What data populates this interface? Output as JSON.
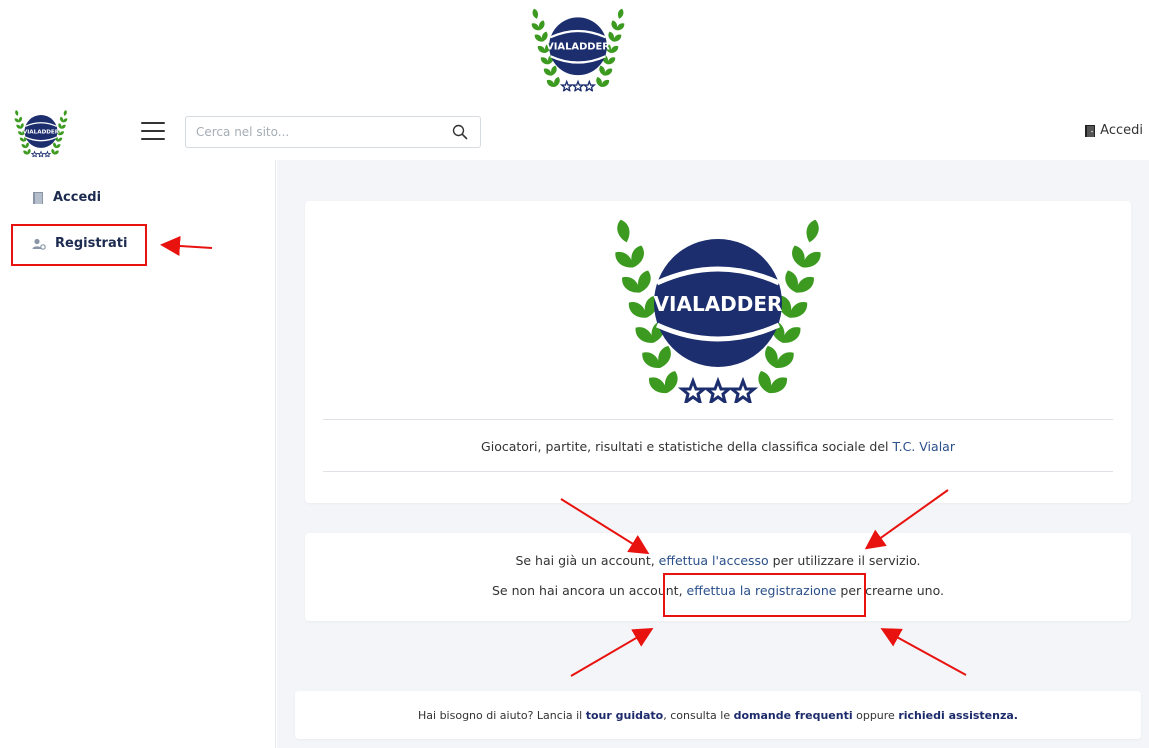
{
  "brand": {
    "logo_text": "VIALADDER"
  },
  "header": {
    "search_placeholder": "Cerca nel sito...",
    "login_label": "Accedi"
  },
  "sidebar": {
    "items": [
      {
        "label": "Accedi",
        "icon": "door-icon"
      },
      {
        "label": "Registrati",
        "icon": "user-add-icon"
      }
    ]
  },
  "hero": {
    "tagline_text": "Giocatori, partite, risultati e statistiche della classifica sociale del ",
    "tagline_link": "T.C. Vialar"
  },
  "info": {
    "line1_pre": "Se hai già un account, ",
    "line1_link": "effettua l'accesso",
    "line1_post": " per utilizzare il servizio.",
    "line2_pre": "Se non hai ancora un account, ",
    "line2_link": "effettua la registrazione",
    "line2_post": " per crearne uno."
  },
  "help": {
    "pre": "Hai bisogno di aiuto? Lancia il ",
    "link1": "tour guidato",
    "mid1": ", consulta le ",
    "link2": "domande frequenti",
    "mid2": " oppure ",
    "link3": "richiedi assistenza."
  },
  "colors": {
    "brand_navy": "#1c2e6e",
    "laurel_green": "#3b9a1f",
    "annotation_red": "#e8120f"
  }
}
